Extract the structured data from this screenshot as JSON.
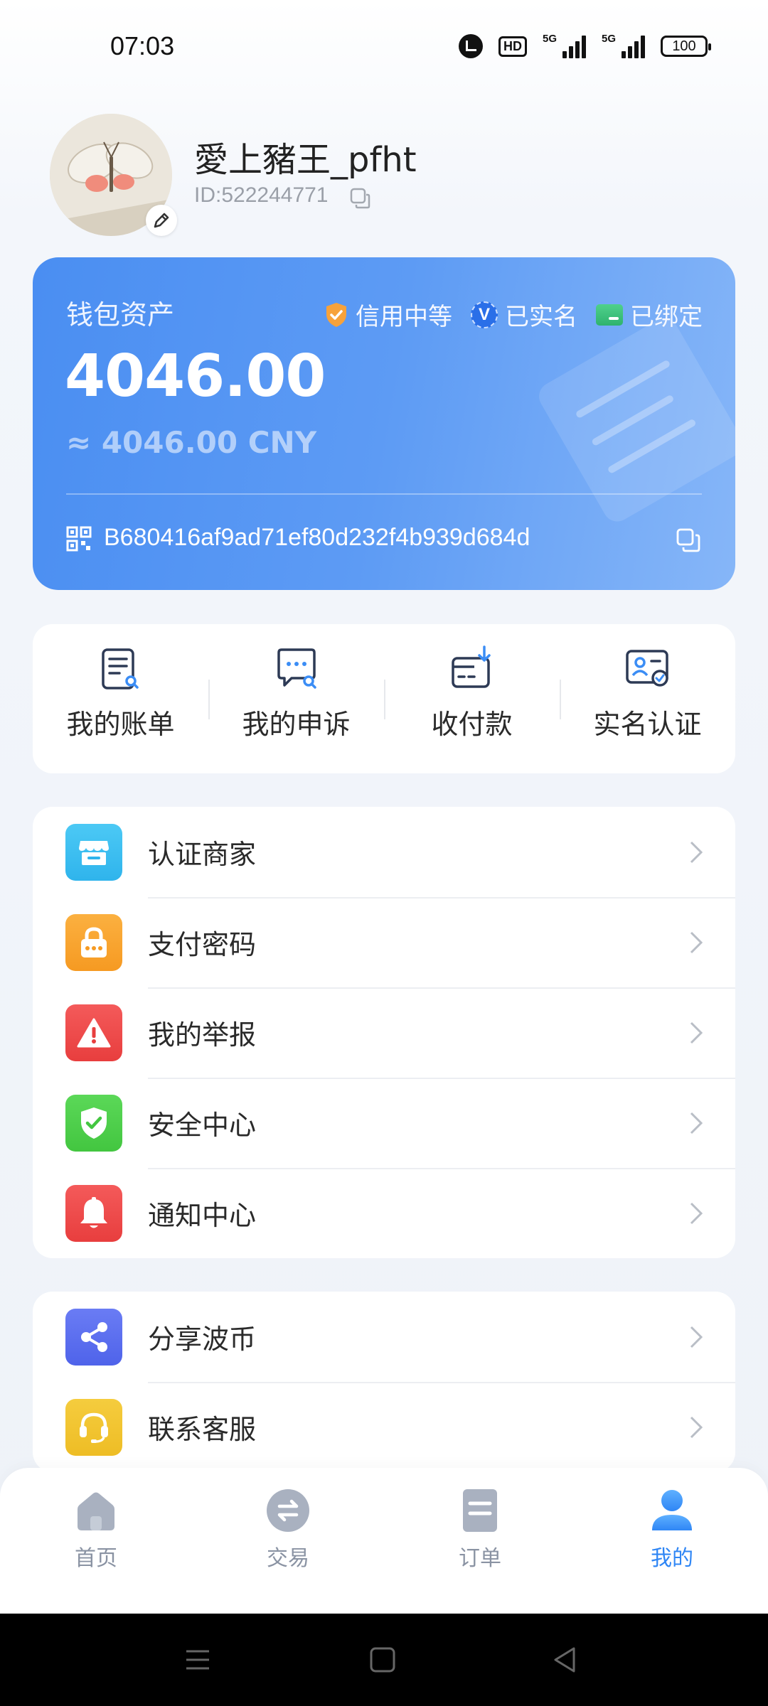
{
  "status_bar": {
    "time": "07:03",
    "hd_label": "HD",
    "network_1": "5G",
    "network_2": "5G",
    "battery": "100"
  },
  "profile": {
    "username": "愛上豬王_pfht",
    "id_text": "ID:522244771",
    "avatar_icon": "butterfly-photo",
    "edit_icon": "pencil-icon",
    "copy_icon": "copy-icon"
  },
  "wallet": {
    "label": "钱包资产",
    "badges": [
      {
        "label": "信用中等",
        "icon": "shield-check-icon",
        "color": "#f7a23b"
      },
      {
        "label": "已实名",
        "icon": "verified-v-icon",
        "color": "#2a6fe8"
      },
      {
        "label": "已绑定",
        "icon": "bank-card-icon",
        "color": "#38c27a"
      }
    ],
    "amount": "4046.00",
    "cny_equivalent": "≈ 4046.00 CNY",
    "address": "B680416af9ad71ef80d232f4b939d684d",
    "card_color": "#5d9bf4"
  },
  "quick_actions": [
    {
      "label": "我的账单",
      "icon": "bill-search-icon"
    },
    {
      "label": "我的申诉",
      "icon": "appeal-chat-icon"
    },
    {
      "label": "收付款",
      "icon": "receive-payment-icon"
    },
    {
      "label": "实名认证",
      "icon": "id-verify-icon"
    }
  ],
  "menu_group_1": [
    {
      "label": "认证商家",
      "icon": "store-icon",
      "color": "#3dbff0"
    },
    {
      "label": "支付密码",
      "icon": "lock-icon",
      "color": "#f9a431"
    },
    {
      "label": "我的举报",
      "icon": "warning-icon",
      "color": "#ef4b4b"
    },
    {
      "label": "安全中心",
      "icon": "shield-check-icon",
      "color": "#4fcf4b"
    },
    {
      "label": "通知中心",
      "icon": "bell-icon",
      "color": "#ef4b4b"
    }
  ],
  "menu_group_2": [
    {
      "label": "分享波币",
      "icon": "share-icon",
      "color": "#5b6ff0"
    },
    {
      "label": "联系客服",
      "icon": "headset-icon",
      "color": "#f2c533"
    }
  ],
  "tabbar": {
    "tabs": [
      {
        "label": "首页",
        "icon": "home-icon",
        "active": false
      },
      {
        "label": "交易",
        "icon": "exchange-icon",
        "active": false
      },
      {
        "label": "订单",
        "icon": "order-icon",
        "active": false
      },
      {
        "label": "我的",
        "icon": "profile-icon",
        "active": true
      }
    ],
    "active_color": "#2f86f5"
  },
  "navbar": {
    "buttons": [
      "menu-nav-icon",
      "home-nav-icon",
      "back-nav-icon"
    ]
  }
}
